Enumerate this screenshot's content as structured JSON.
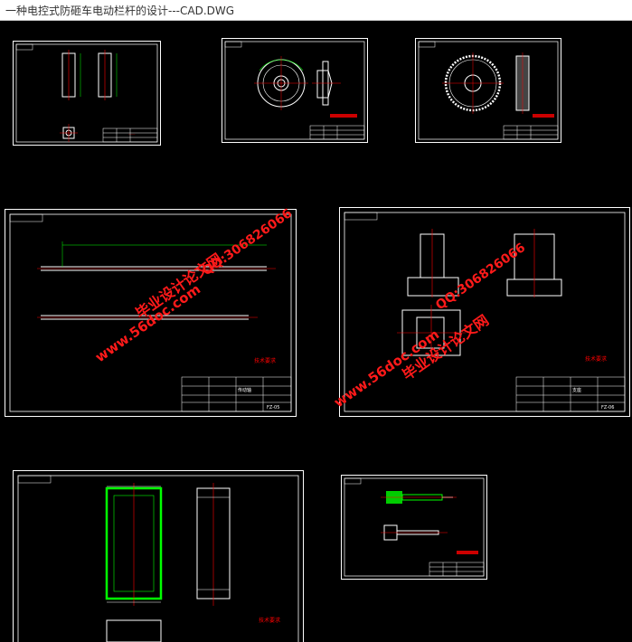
{
  "window": {
    "title": "一种电控式防砸车电动栏杆的设计---CAD.DWG"
  },
  "sheets": [
    {
      "id": 1,
      "title_block_code": "",
      "note_label": ""
    },
    {
      "id": 2,
      "title_block_code": "",
      "note_label": ""
    },
    {
      "id": 3,
      "title_block_code": "",
      "note_label": ""
    },
    {
      "id": 4,
      "title_block_code": "FZ-05",
      "note_label": "技术要求",
      "part_name": "传动轴"
    },
    {
      "id": 5,
      "title_block_code": "FZ-06",
      "note_label": "技术要求",
      "part_name": "支座"
    },
    {
      "id": 6,
      "title_block_code": "",
      "note_label": "技术要求"
    },
    {
      "id": 7,
      "title_block_code": "",
      "note_label": ""
    }
  ],
  "watermarks": {
    "site": "www.56doc.com",
    "qq": "QQ:306826066",
    "brand": "毕业设计论文网"
  },
  "colors": {
    "background": "#000000",
    "frame": "#ffffff",
    "geometry_green": "#00ff00",
    "centerline_red": "#ff0000",
    "watermark_red": "#ff1a1a",
    "dimension_yellow": "#ffff00",
    "title_block_cyan": "#00ffff"
  }
}
